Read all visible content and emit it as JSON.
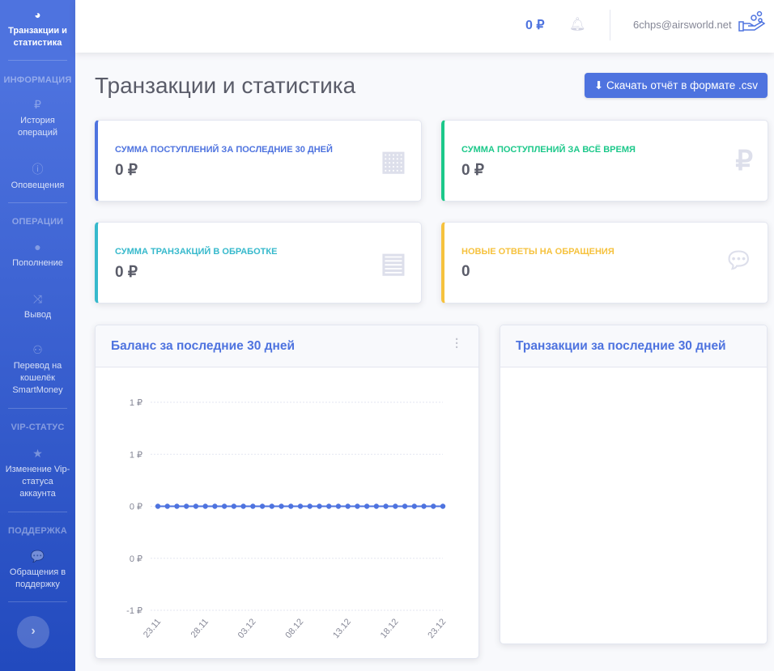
{
  "sidebar": {
    "active": "Транзакции и статистика",
    "headings": [
      "ИНФОРМАЦИЯ",
      "ОПЕРАЦИИ",
      "VIP-СТАТУС",
      "ПОДДЕРЖКА"
    ],
    "items": [
      "История операций",
      "Оповещения",
      "Пополнение",
      "Вывод",
      "Перевод на кошелёк SmartMoney",
      "Изменение Vip-статуса аккаунта",
      "Обращения в поддержку"
    ],
    "toggle": "›"
  },
  "topbar": {
    "balance": "0 ₽",
    "email": "6chps@airsworld.net"
  },
  "page": {
    "title": "Транзакции и статистика",
    "download": "Скачать отчёт в формате .csv"
  },
  "stats": [
    {
      "label": "Сумма поступлений за последние 30 дней",
      "value": "0 ₽",
      "color": "#4e73df",
      "icon": "calendar-icon"
    },
    {
      "label": "Сумма поступлений за всё время",
      "value": "0 ₽",
      "color": "#1cc88a",
      "icon": "ruble-icon"
    },
    {
      "label": "Сумма транзакций в обработке",
      "value": "0 ₽",
      "color": "#36b9cc",
      "icon": "clipboard-icon"
    },
    {
      "label": "Новые ответы на обращения",
      "value": "0",
      "color": "#f6c23e",
      "icon": "comments-icon"
    }
  ],
  "charts": {
    "balance_title": "Баланс за последние 30 дней",
    "transactions_title": "Транзакции за последние 30 дней"
  },
  "chart_data": {
    "type": "line",
    "title": "Баланс за последние 30 дней",
    "y_tick_labels": [
      "1 ₽",
      "1 ₽",
      "0 ₽",
      "0 ₽",
      "-1 ₽"
    ],
    "ylim": [
      -1,
      1
    ],
    "x_tick_labels": [
      "23.11",
      "28.11",
      "03.12",
      "08.12",
      "13.12",
      "18.12",
      "23.12"
    ],
    "series": [
      {
        "name": "Баланс",
        "color": "#4e73df",
        "values": [
          0,
          0,
          0,
          0,
          0,
          0,
          0,
          0,
          0,
          0,
          0,
          0,
          0,
          0,
          0,
          0,
          0,
          0,
          0,
          0,
          0,
          0,
          0,
          0,
          0,
          0,
          0,
          0,
          0,
          0,
          0
        ]
      }
    ],
    "grid": true
  }
}
